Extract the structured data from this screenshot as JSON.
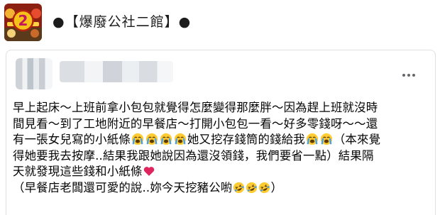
{
  "header": {
    "group_title": "●【爆廢公社二館】●",
    "logo_label": "2"
  },
  "post": {
    "lines": [
      "早上起床～上班前拿小包包就覺得怎麼變得那麼胖～因為趕上班就沒時",
      "間見看～到了工地附近的早餐店～打開小包包一看～好多零錢呀～～還"
    ],
    "line3_a": "有一張女兒寫的小紙條",
    "line3_b": "她又挖存錢筒的錢給我",
    "line3_c": "（本來覺",
    "line4": "得她要我去按摩..結果我跟她說因為還沒領錢，我們要省一點）結果隔",
    "line5": "天就發現這些錢和小紙條",
    "line6_a": "（早餐店老闆還可愛的說..妳今天挖豬公喲",
    "line6_b": "）"
  },
  "icons": {
    "more": "more-horizontal-icon",
    "cry": "loudly-crying-face-emoji",
    "heart": "red-heart-emoji",
    "rofl": "rolling-on-floor-laughing-emoji"
  },
  "colors": {
    "text": "#050505",
    "border": "#dddfe2",
    "more_dots": "#65676b",
    "heart": "#e0245e"
  }
}
